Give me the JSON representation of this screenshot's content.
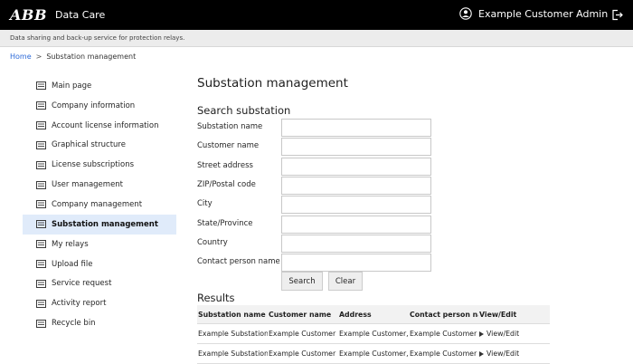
{
  "header": {
    "logo_text": "ABB",
    "app_title": "Data Care",
    "user_name": "Example Customer Admin",
    "user_icon": "user-circle-icon",
    "logout_icon": "logout-icon"
  },
  "subbar": {
    "text": "Data sharing and back-up service for protection relays."
  },
  "breadcrumb": {
    "home": "Home",
    "separator": ">",
    "current": "Substation management"
  },
  "sidebar": {
    "items": [
      {
        "label": "Main page",
        "icon": "menu-item-icon"
      },
      {
        "label": "Company information",
        "icon": "menu-item-icon"
      },
      {
        "label": "Account license information",
        "icon": "menu-item-icon"
      },
      {
        "label": "Graphical structure",
        "icon": "menu-item-icon"
      },
      {
        "label": "License subscriptions",
        "icon": "menu-item-icon"
      },
      {
        "label": "User management",
        "icon": "menu-item-icon"
      },
      {
        "label": "Company management",
        "icon": "menu-item-icon"
      },
      {
        "label": "Substation management",
        "icon": "menu-item-icon",
        "active": true
      },
      {
        "label": "My relays",
        "icon": "menu-item-icon"
      },
      {
        "label": "Upload file",
        "icon": "menu-item-icon"
      },
      {
        "label": "Service request",
        "icon": "menu-item-icon"
      },
      {
        "label": "Activity report",
        "icon": "menu-item-icon"
      },
      {
        "label": "Recycle bin",
        "icon": "menu-item-icon"
      }
    ]
  },
  "main": {
    "page_title": "Substation management",
    "search_title": "Search substation",
    "fields": [
      {
        "label": "Substation name",
        "value": ""
      },
      {
        "label": "Customer name",
        "value": ""
      },
      {
        "label": "Street address",
        "value": ""
      },
      {
        "label": "ZIP/Postal code",
        "value": ""
      },
      {
        "label": "City",
        "value": ""
      },
      {
        "label": "State/Province",
        "value": ""
      },
      {
        "label": "Country",
        "value": ""
      },
      {
        "label": "Contact person name",
        "value": ""
      }
    ],
    "search_button": "Search",
    "clear_button": "Clear",
    "results_title": "Results",
    "table": {
      "columns": [
        "Substation name",
        "Customer name",
        "Address",
        "Contact person nan",
        "View/Edit"
      ],
      "rows": [
        {
          "substation": "Example Substation",
          "customer": "Example Customer",
          "address": "Example Customer, :",
          "contact": "Example Customer F",
          "action": "View/Edit"
        },
        {
          "substation": "Example Substation",
          "customer": "Example Customer",
          "address": "Example Customer, :",
          "contact": "Example Customer F",
          "action": "View/Edit"
        }
      ]
    }
  },
  "colors": {
    "topbar": "#000000",
    "subbar": "#ececec",
    "link": "#2c6ad8",
    "active_item": "#e0ebfa"
  }
}
